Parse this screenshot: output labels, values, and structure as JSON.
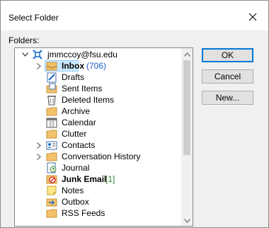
{
  "dialog": {
    "title": "Select Folder",
    "folders_label": "Folders:"
  },
  "buttons": {
    "ok": "OK",
    "cancel": "Cancel",
    "new": "New..."
  },
  "tree": {
    "account": "jmmccoy@fsu.edu",
    "items": [
      {
        "label": "Inbox",
        "count": "(706)",
        "bold": true,
        "icon": "inbox-icon"
      },
      {
        "label": "Drafts",
        "icon": "drafts-icon"
      },
      {
        "label": "Sent Items",
        "icon": "sent-items-icon"
      },
      {
        "label": "Deleted Items",
        "icon": "deleted-items-icon"
      },
      {
        "label": "Archive",
        "icon": "folder-icon"
      },
      {
        "label": "Calendar",
        "icon": "calendar-icon"
      },
      {
        "label": "Clutter",
        "icon": "folder-icon"
      },
      {
        "label": "Contacts",
        "icon": "contacts-icon"
      },
      {
        "label": "Conversation History",
        "icon": "folder-icon"
      },
      {
        "label": "Journal",
        "icon": "journal-icon"
      },
      {
        "label": "Junk Email",
        "count": "[1]",
        "bold": true,
        "icon": "junk-email-icon"
      },
      {
        "label": "Notes",
        "icon": "notes-icon"
      },
      {
        "label": "Outbox",
        "icon": "outbox-icon"
      },
      {
        "label": "RSS Feeds",
        "icon": "folder-icon"
      }
    ]
  },
  "colors": {
    "selection": "#cce8ff",
    "folder": "#f3c26b",
    "accent": "#0078d7"
  }
}
